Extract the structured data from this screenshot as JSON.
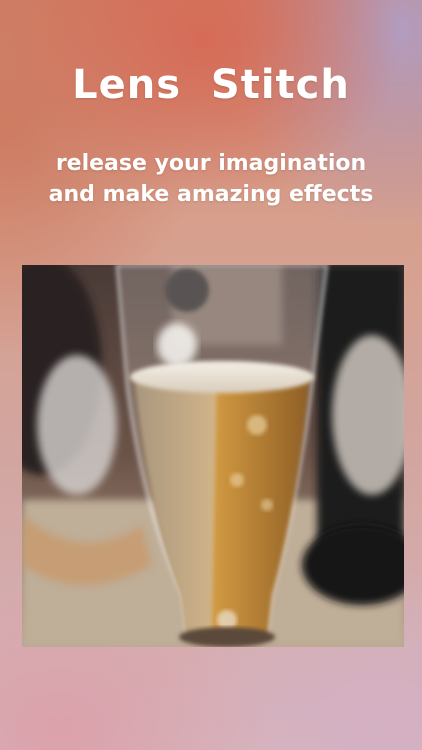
{
  "app": {
    "title": "Lens  Stitch",
    "tagline_line1": "release your imagination",
    "tagline_line2": "and make amazing effects"
  },
  "photo": {
    "subject": "glass of beer"
  },
  "colors": {
    "text": "#ffffff",
    "background_top": "#cf7e66",
    "background_bottom": "#d6b4bb",
    "beer_amber": "#c98a32"
  }
}
